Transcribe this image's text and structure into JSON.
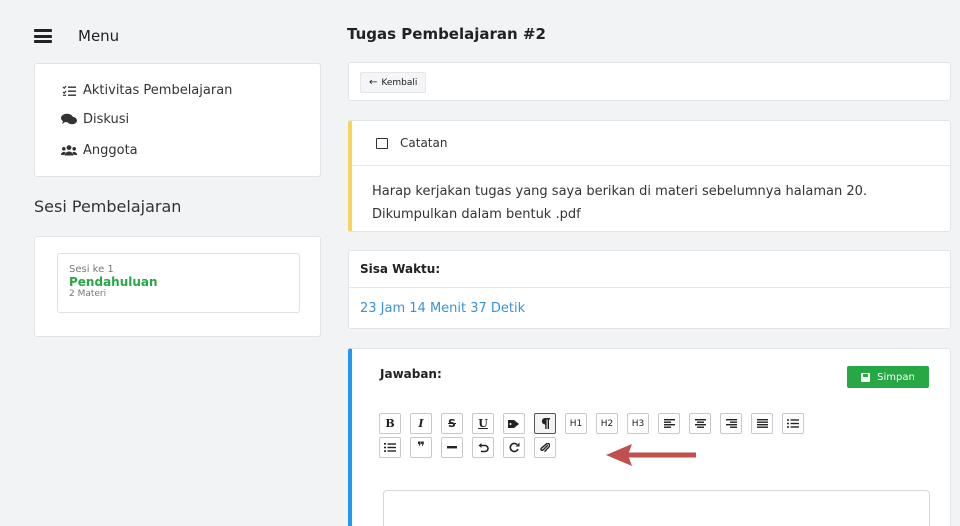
{
  "sidebar": {
    "menu_label": "Menu",
    "items": [
      {
        "label": "Aktivitas Pembelajaran",
        "icon": "tasks-icon"
      },
      {
        "label": "Diskusi",
        "icon": "comments-icon"
      },
      {
        "label": "Anggota",
        "icon": "users-icon"
      }
    ],
    "sesi_title": "Sesi Pembelajaran",
    "sesi": {
      "ke": "Sesi ke 1",
      "name": "Pendahuluan",
      "count": "2 Materi"
    }
  },
  "main": {
    "title": "Tugas Pembelajaran #2",
    "back_label": "Kembali",
    "catatan": {
      "title": "Catatan",
      "text": "Harap kerjakan tugas yang saya berikan di materi sebelumnya halaman 20. Dikumpulkan dalam bentuk .pdf"
    },
    "waktu": {
      "title": "Sisa Waktu:",
      "value": "23 Jam 14 Menit 37 Detik"
    },
    "jawaban": {
      "title": "Jawaban:",
      "save_label": "Simpan",
      "toolbar": {
        "bold": "B",
        "italic": "I",
        "strike": "S",
        "underline": "U",
        "h1": "H1",
        "h2": "H2",
        "h3": "H3",
        "quote": "❞"
      }
    }
  },
  "colors": {
    "accent_green": "#28a745",
    "accent_blue": "#2196f3",
    "note_yellow": "#f6d55c",
    "link_blue": "#3a93d9",
    "arrow_red": "#c0504d"
  }
}
